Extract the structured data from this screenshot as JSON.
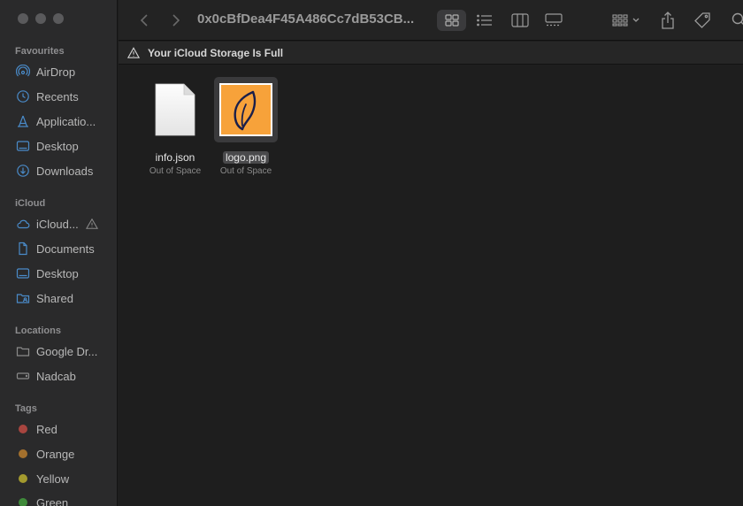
{
  "window": {
    "title": "0x0cBfDea4F45A486Cc7dB53CB..."
  },
  "sidebar": {
    "favourites_title": "Favourites",
    "favourites": [
      {
        "label": "AirDrop",
        "icon": "airdrop-icon"
      },
      {
        "label": "Recents",
        "icon": "clock-icon"
      },
      {
        "label": "Applicatio...",
        "icon": "applications-icon"
      },
      {
        "label": "Desktop",
        "icon": "desktop-icon"
      },
      {
        "label": "Downloads",
        "icon": "download-icon"
      }
    ],
    "icloud_title": "iCloud",
    "icloud": [
      {
        "label": "iCloud...",
        "icon": "cloud-icon"
      },
      {
        "label": "Documents",
        "icon": "document-icon"
      },
      {
        "label": "Desktop",
        "icon": "desktop-icon"
      },
      {
        "label": "Shared",
        "icon": "shared-folder-icon"
      }
    ],
    "locations_title": "Locations",
    "locations": [
      {
        "label": "Google Dr...",
        "icon": "folder-icon"
      },
      {
        "label": "Nadcab",
        "icon": "disk-icon"
      }
    ],
    "tags_title": "Tags",
    "tags": [
      {
        "label": "Red",
        "color": "#a8453f"
      },
      {
        "label": "Orange",
        "color": "#a3702d"
      },
      {
        "label": "Yellow",
        "color": "#a39a2e"
      },
      {
        "label": "Green",
        "color": "#3f8a3a"
      }
    ]
  },
  "banner": {
    "text": "Your iCloud Storage Is Full",
    "icon": "warning-icon"
  },
  "files": [
    {
      "name": "info.json",
      "status": "Out of Space",
      "selected": false
    },
    {
      "name": "logo.png",
      "status": "Out of Space",
      "selected": true
    }
  ],
  "colors": {
    "logo_bg": "#f7a23a",
    "logo_stroke": "#1b1f4a",
    "accent_sidebar_icon": "#4a8bc9"
  }
}
